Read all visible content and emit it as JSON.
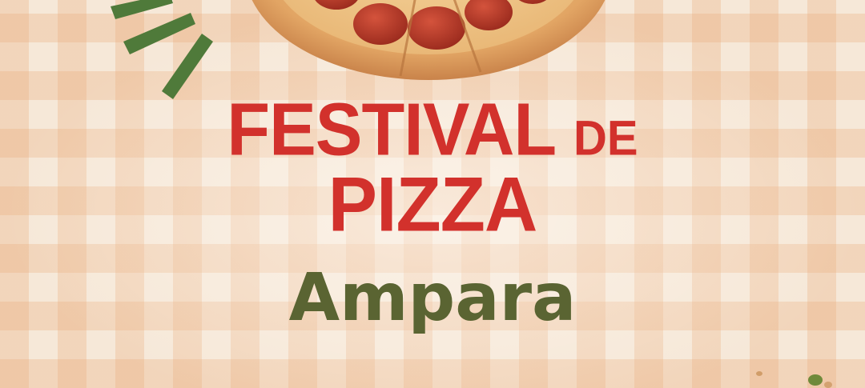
{
  "poster": {
    "title_line_1": "FESTIVAL",
    "title_line_1_small": "DE",
    "title_line_2": "PIZZA",
    "location": "Ampara"
  },
  "colors": {
    "title_red": "#d2312c",
    "location_olive": "#5a6432",
    "burst_green": "#4f7a3a",
    "tablecloth": "#f6e8d8"
  },
  "icons": {
    "pizza": "pepperoni-pizza-illustration",
    "burst": "green-burst-lines",
    "crumbs": "crumbs-decoration"
  }
}
